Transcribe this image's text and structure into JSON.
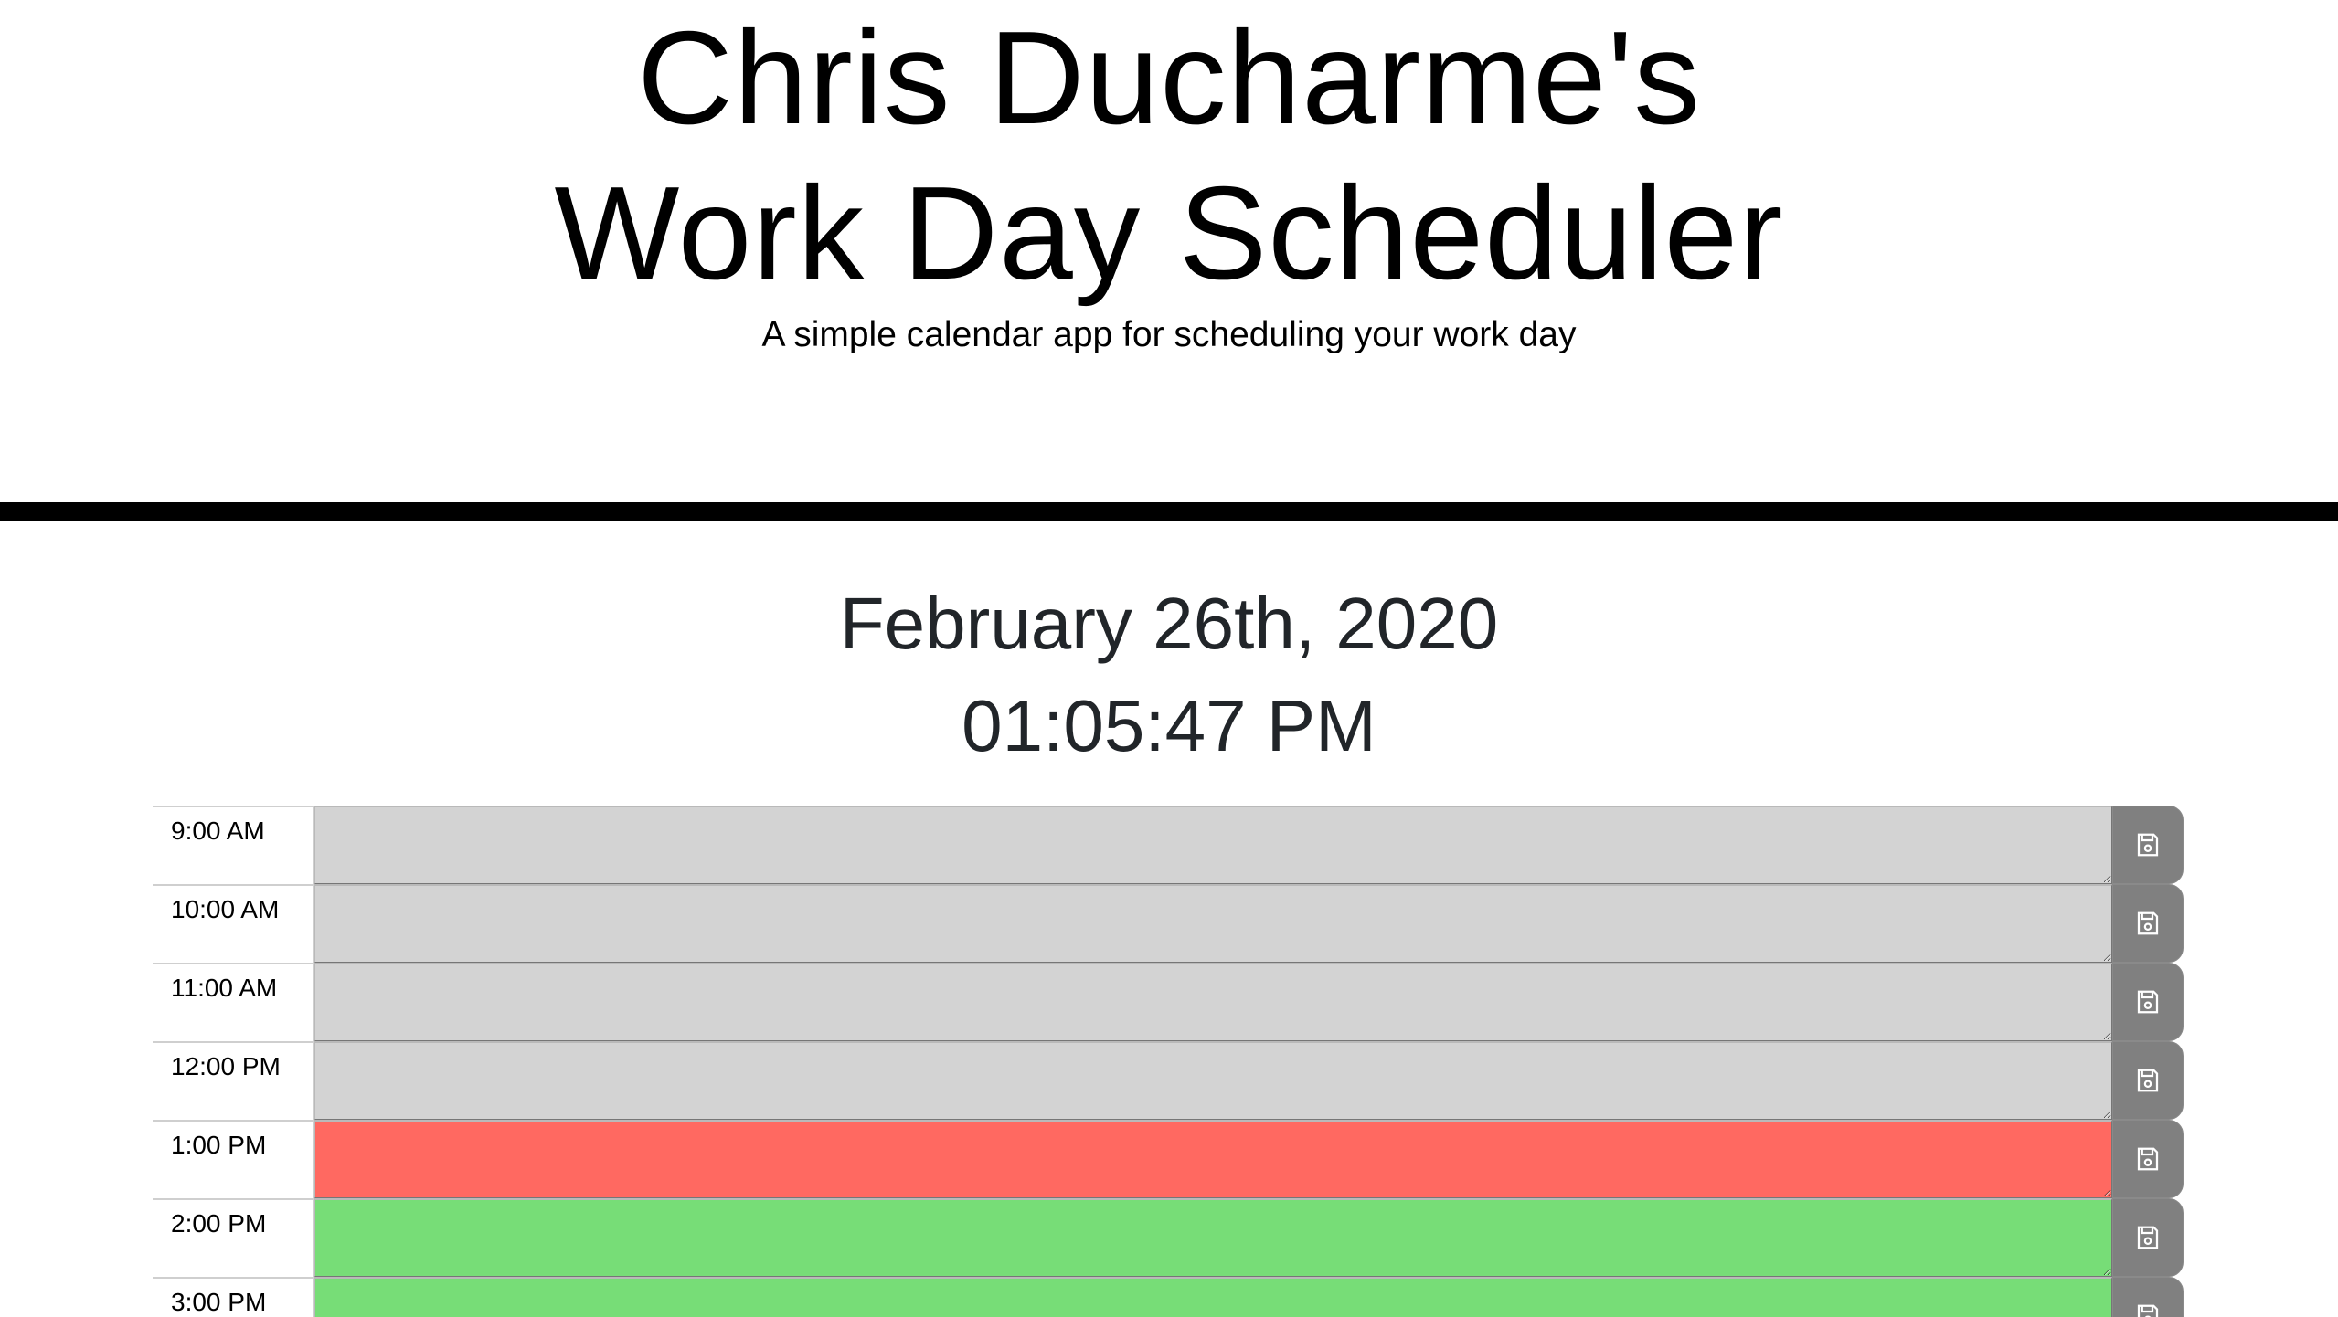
{
  "header": {
    "title_line1": "Chris Ducharme's",
    "title_line2": "Work Day Scheduler",
    "subtitle": "A simple calendar app for scheduling your work day"
  },
  "current": {
    "date": "February 26th, 2020",
    "time": "01:05:47 PM"
  },
  "schedule": {
    "rows": [
      {
        "hour": "9:00 AM",
        "status": "past",
        "text": ""
      },
      {
        "hour": "10:00 AM",
        "status": "past",
        "text": ""
      },
      {
        "hour": "11:00 AM",
        "status": "past",
        "text": ""
      },
      {
        "hour": "12:00 PM",
        "status": "past",
        "text": ""
      },
      {
        "hour": "1:00 PM",
        "status": "present",
        "text": ""
      },
      {
        "hour": "2:00 PM",
        "status": "future",
        "text": ""
      },
      {
        "hour": "3:00 PM",
        "status": "future",
        "text": ""
      }
    ],
    "save_icon": "floppy-disk-icon"
  },
  "colors": {
    "past": "#d3d3d3",
    "present": "#ff6961",
    "future": "#77dd77",
    "save_button": "#808080",
    "divider": "#000000"
  }
}
